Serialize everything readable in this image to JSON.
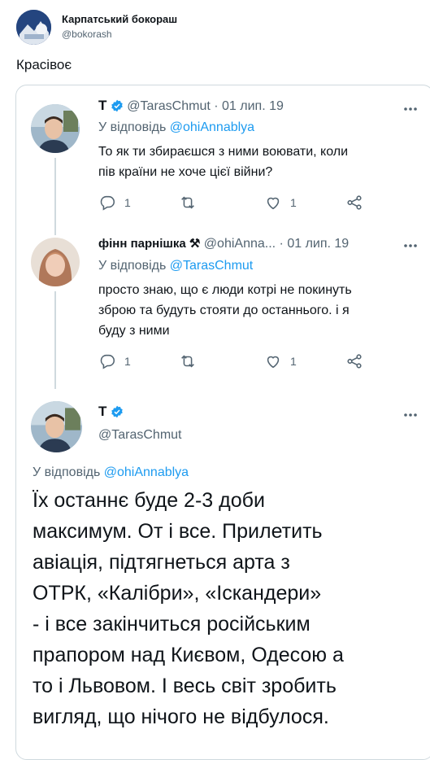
{
  "outer_tweet": {
    "author_name": "Карпатський бокораш",
    "author_handle": "@bokorash",
    "text": "Красівоє"
  },
  "thread": [
    {
      "author_name": "T",
      "author_handle": "@TarasChmut",
      "date": "· 01 лип. 19",
      "reply_prefix": "У відповідь",
      "reply_to": "@ohiAnnablya",
      "text_lines": [
        "То як ти збираєшся з ними воювати, коли",
        "пів країни не хоче цієї війни?"
      ],
      "replies": "1",
      "likes": "1"
    },
    {
      "author_name": "фінн парнішка ⚒",
      "author_handle": "@ohiAnna...",
      "date": "· 01 лип. 19",
      "reply_prefix": "У відповідь",
      "reply_to": "@TarasChmut",
      "text_lines": [
        "просто знаю, що є люди котрі не покинуть",
        "зброю та будуть стояти до останнього. і я",
        "буду з ними"
      ],
      "replies": "1",
      "likes": "1"
    }
  ],
  "main_tweet": {
    "author_name": "T",
    "author_handle": "@TarasChmut",
    "reply_prefix": "У відповідь",
    "reply_to": "@ohiAnnablya",
    "text_lines": [
      "Їх останнє буде 2-3 доби",
      "максимум. От і все. Прилетить",
      "авіація, підтягнеться арта з",
      "ОТРК, «Калібри», «Іскандери»",
      "- і все закінчиться російським",
      "прапором над Києвом, Одесою а",
      "то і Львовом. І весь світ зробить",
      "вигляд, що нічого не відбулося."
    ]
  },
  "colors": {
    "accent": "#1d9bf0",
    "muted": "#536471",
    "border": "#cfd9de"
  }
}
